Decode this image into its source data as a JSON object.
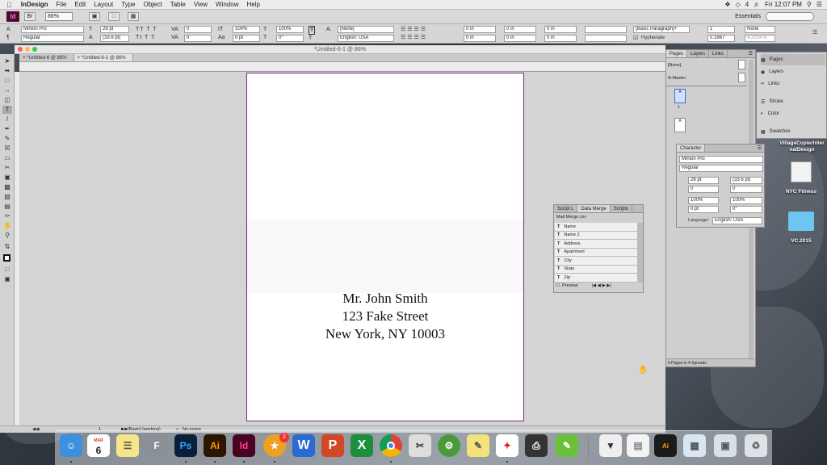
{
  "menubar": {
    "apple": "",
    "app_name": "InDesign",
    "items": [
      "File",
      "Edit",
      "Layout",
      "Type",
      "Object",
      "Table",
      "View",
      "Window",
      "Help"
    ],
    "clock": "Fri 12:07 PM",
    "battery": "4"
  },
  "appbar": {
    "logo": "Id",
    "zoom": "86%",
    "workspace": "Essentials",
    "search_placeholder": ""
  },
  "control": {
    "font_family": "Minion Pro",
    "font_style": "Regular",
    "font_size": "28 pt",
    "leading": "(33.6 pt)",
    "kerning": "0",
    "tracking": "0",
    "vscale": "100%",
    "hscale": "100%",
    "baseline": "0 pt",
    "skew": "0°",
    "char_style": "[None]",
    "language": "English: USA",
    "indent_left": "0 in",
    "indent_first": "0 in",
    "indent_right": "0 in",
    "indent_last": "0 in",
    "space_before": "0 in",
    "space_after": "0 in",
    "para_style": "[Basic Paragraph]+",
    "hyphenate": "Hyphenate",
    "columns": "1",
    "gutter": "0.1667",
    "col_extra": "None",
    "col_val": "4.2014 in"
  },
  "document": {
    "window_title": "*Untitled-6-1 @ 86%",
    "tabs": [
      "*Untitled-6 @ 86%",
      "*Untitled-6-1 @ 86%"
    ],
    "address_lines": [
      "Mr. John Smith",
      "123 Fake Street",
      "New York, NY 10003"
    ]
  },
  "status": {
    "page": "1",
    "style": "[Basic] (working)",
    "errors": "No errors"
  },
  "pages_panel": {
    "tabs": [
      "Pages",
      "Layers",
      "Links"
    ],
    "none_label": "[None]",
    "master_label": "A-Master",
    "page_letter": "A",
    "page_number": "1",
    "footer": "4 Pages in 4 Spreads"
  },
  "side_dock": {
    "items": [
      "Pages",
      "Layers",
      "Links",
      "Stroke",
      "Color",
      "Swatches"
    ]
  },
  "character_panel": {
    "title": "Character",
    "font": "Minion Pro",
    "style": "Regular",
    "size": "28 pt",
    "leading": "(33.6 pt)",
    "kerning": "0",
    "tracking": "0",
    "vscale": "100%",
    "hscale": "100%",
    "baseline": "0 pt",
    "skew": "0°",
    "language_label": "Language:",
    "language": "English: USA"
  },
  "data_merge": {
    "tabs": [
      "Script L",
      "Data Merge",
      "Scripts"
    ],
    "source": "Mail Merge.csv",
    "fields": [
      "Name",
      "Name 2",
      "Address",
      "Apartment",
      "City",
      "State",
      "Zip"
    ],
    "preview_label": "Preview"
  },
  "desktop_icons": [
    {
      "label": "VillageCopierInternalDesign"
    },
    {
      "label": "NYC Fitness"
    },
    {
      "label": "VC.2015"
    }
  ],
  "dock": {
    "calendar_month": "MAR",
    "calendar_day": "6",
    "badge": "2",
    "apps": [
      "Finder",
      "Calendar",
      "Notes",
      "FontBook",
      "Ps",
      "Ai",
      "Id",
      "Rocket",
      "W",
      "P",
      "X",
      "Chrome",
      "Preview",
      "Xcode",
      "Stickies",
      "Acrobat",
      "Printer",
      "Evernote"
    ]
  }
}
